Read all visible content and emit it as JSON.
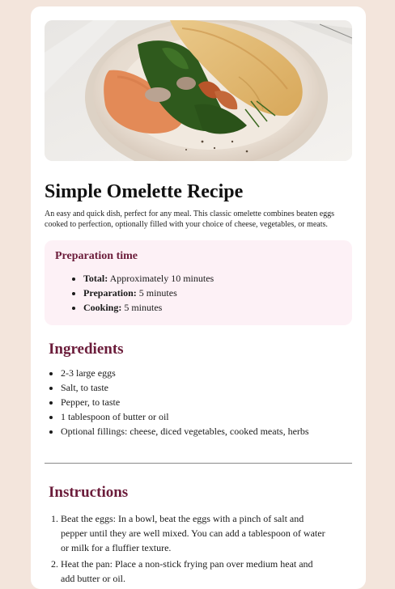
{
  "hero_image": {
    "alt": "Omelette on a plate with spinach and mushrooms"
  },
  "recipe": {
    "title": "Simple Omelette Recipe",
    "intro": "An easy and quick dish, perfect for any meal. This classic omelette combines beaten eggs cooked to perfection, optionally filled with your choice of cheese, vegetables, or meats."
  },
  "prep": {
    "heading": "Preparation time",
    "items": [
      {
        "label": "Total:",
        "value": " Approximately 10 minutes"
      },
      {
        "label": "Preparation:",
        "value": " 5 minutes"
      },
      {
        "label": "Cooking:",
        "value": " 5 minutes"
      }
    ]
  },
  "ingredients": {
    "heading": "Ingredients",
    "items": [
      "2-3 large eggs",
      "Salt, to taste",
      "Pepper, to taste",
      "1 tablespoon of butter or oil",
      "Optional fillings: cheese, diced vegetables, cooked meats, herbs"
    ]
  },
  "instructions": {
    "heading": "Instructions",
    "steps": [
      "Beat the eggs: In a bowl, beat the eggs with a pinch of salt and pepper until they are well mixed. You can add a tablespoon of water or milk for a fluffier texture.",
      "Heat the pan: Place a non-stick frying pan over medium heat and add butter or oil."
    ]
  },
  "colors": {
    "page_bg": "#f3e5dc",
    "card_bg": "#ffffff",
    "accent": "#6b1c3a",
    "prep_bg": "#fdf1f6"
  }
}
